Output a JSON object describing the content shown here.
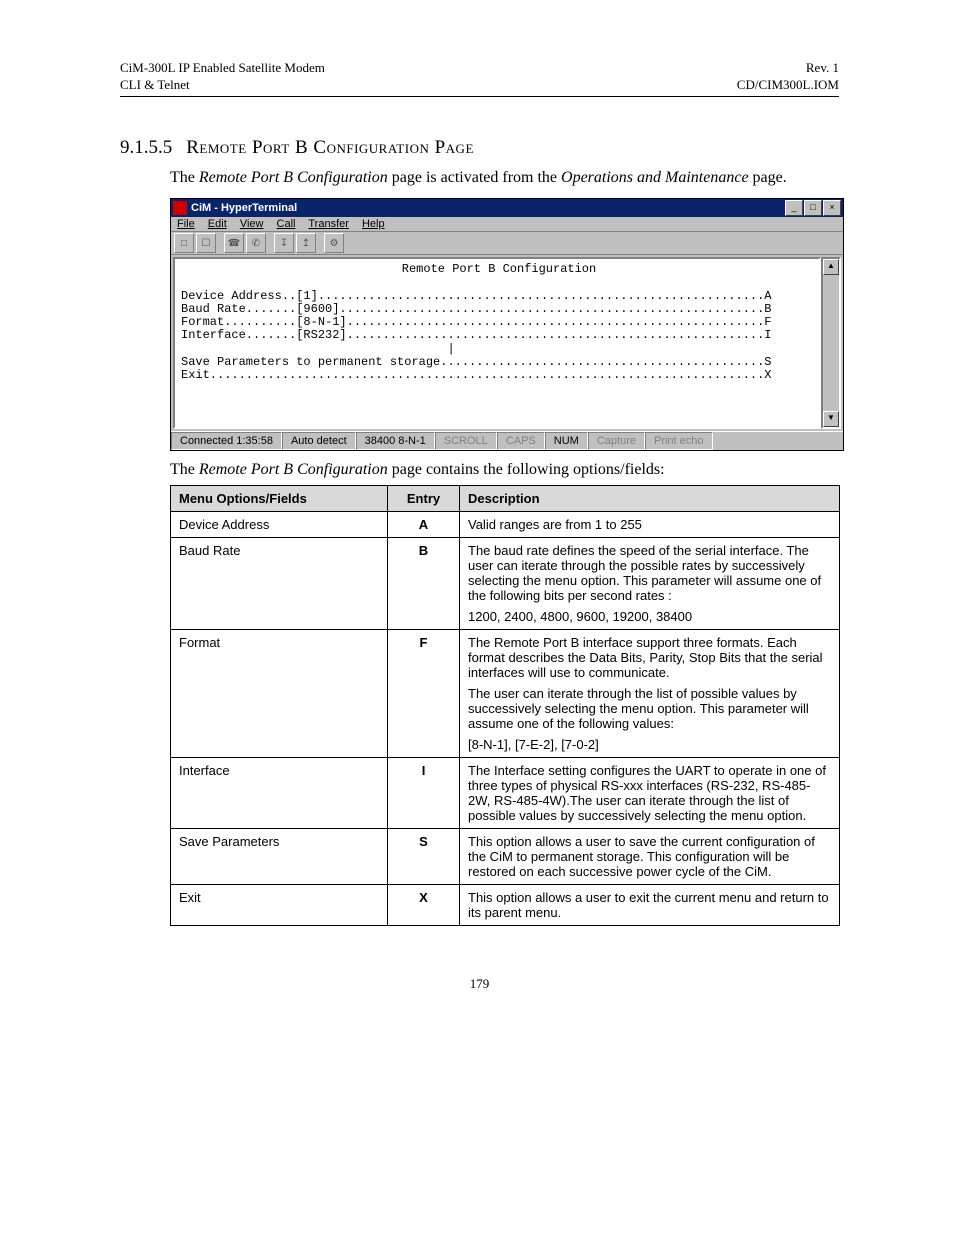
{
  "header": {
    "left1": "CiM-300L IP Enabled Satellite Modem",
    "left2": "CLI & Telnet",
    "right1": "Rev. 1",
    "right2": "CD/CIM300L.IOM"
  },
  "section": {
    "number": "9.1.5.5",
    "title": "Remote Port B Configuration Page"
  },
  "intro1_a": "The ",
  "intro1_b": "Remote Port B Configuration",
  "intro1_c": " page is activated from the ",
  "intro1_d": "Operations and Maintenance",
  "intro1_e": " page.",
  "hyperterm": {
    "title": "CiM - HyperTerminal",
    "menus": {
      "file": "File",
      "edit": "Edit",
      "view": "View",
      "call": "Call",
      "transfer": "Transfer",
      "help": "Help"
    },
    "content_title": "Remote Port B Configuration",
    "line1": "Device Address..[1]..............................................................A",
    "line2": "Baud Rate.......[9600]...........................................................B",
    "line3": "Format..........[8-N-1]..........................................................F",
    "line4": "Interface.......[RS232]..........................................................I",
    "line5": "                                     |",
    "line6": "Save Parameters to permanent storage.............................................S",
    "line7": "Exit.............................................................................X",
    "status": {
      "conn": "Connected 1:35:58",
      "detect": "Auto detect",
      "rate": "38400 8-N-1",
      "scroll": "SCROLL",
      "caps": "CAPS",
      "num": "NUM",
      "capture": "Capture",
      "echo": "Print echo"
    }
  },
  "intro2_a": "The ",
  "intro2_b": "Remote Port B Configuration",
  "intro2_c": " page contains the following options/fields:",
  "table": {
    "heads": {
      "menu": "Menu Options/Fields",
      "entry": "Entry",
      "desc": "Description"
    },
    "rows": [
      {
        "menu": "Device Address",
        "entry": "A",
        "desc": [
          "Valid ranges are from 1 to 255"
        ]
      },
      {
        "menu": "Baud Rate",
        "entry": "B",
        "desc": [
          "The baud rate defines the speed of the serial interface. The user can iterate through the possible rates by successively selecting the menu option. This parameter will assume one of the following bits per second rates :",
          "1200, 2400, 4800, 9600, 19200, 38400"
        ]
      },
      {
        "menu": "Format",
        "entry": "F",
        "desc": [
          "The Remote Port B interface support three formats. Each format describes the Data Bits, Parity, Stop Bits that the serial interfaces will use to communicate.",
          "The user can iterate through the list of possible values by successively selecting the menu option. This parameter will assume one of the following values:",
          "[8-N-1], [7-E-2], [7-0-2]"
        ]
      },
      {
        "menu": "Interface",
        "entry": "I",
        "desc": [
          "The Interface setting configures the UART to operate in one of three types of physical RS-xxx interfaces (RS-232, RS-485-2W, RS-485-4W).The user can iterate through the list of possible values by successively selecting the menu option."
        ]
      },
      {
        "menu": "Save Parameters",
        "entry": "S",
        "desc": [
          "This option allows a user to save the current configuration of the CiM to permanent storage. This configuration will be restored on each successive power cycle of the CiM."
        ]
      },
      {
        "menu": "Exit",
        "entry": "X",
        "desc": [
          "This option allows a user to exit the current menu and return to its parent menu."
        ]
      }
    ]
  },
  "page_number": "179"
}
